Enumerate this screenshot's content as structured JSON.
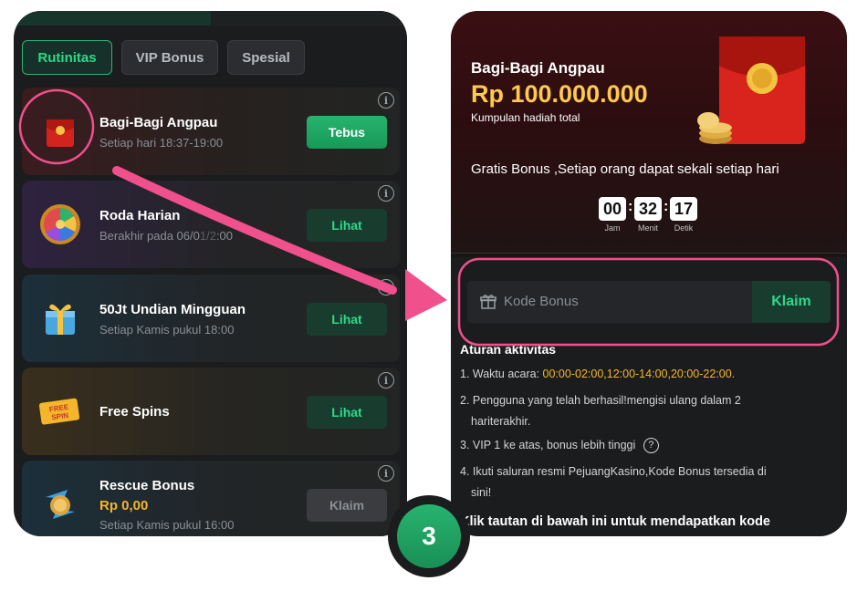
{
  "left": {
    "tabs": [
      {
        "label": "Rutinitas",
        "active": true
      },
      {
        "label": "VIP Bonus",
        "active": false
      },
      {
        "label": "Spesial",
        "active": false
      }
    ],
    "rows": [
      {
        "title": "Bagi-Bagi Angpau",
        "subtitle": "Setiap hari 18:37-19:00",
        "button": "Tebus",
        "icon": "red-envelope-icon"
      },
      {
        "title": "Roda Harian",
        "subtitle": "Berakhir pada 06/0",
        "subtitle_tail": ":00",
        "button": "Lihat",
        "icon": "wheel-icon"
      },
      {
        "title": "50Jt Undian Mingguan",
        "subtitle": "Setiap Kamis pukul 18:00",
        "button": "Lihat",
        "icon": "gift-box-icon"
      },
      {
        "title": "Free Spins",
        "subtitle": "",
        "button": "Lihat",
        "icon": "free-spin-ticket-icon",
        "ticket_text_1": "FREE",
        "ticket_text_2": "SPIN"
      },
      {
        "title": "Rescue Bonus",
        "amount": "Rp 0,00",
        "subtitle": "Setiap Kamis pukul 16:00",
        "button": "Klaim",
        "icon": "rescue-coin-icon"
      }
    ],
    "info_glyph": "i"
  },
  "right": {
    "hero_title": "Bagi-Bagi Angpau",
    "hero_amount": "Rp 100.000.000",
    "hero_caption": "Kumpulan hadiah total",
    "description": "Gratis Bonus ,Setiap orang dapat sekali setiap hari",
    "timer": [
      {
        "value": "00",
        "label": "Jam"
      },
      {
        "value": "32",
        "label": "Menit"
      },
      {
        "value": "17",
        "label": "Detik"
      }
    ],
    "code_placeholder": "Kode Bonus",
    "claim_button": "Klaim",
    "rules_title": "Aturan aktivitas",
    "rules": {
      "r1_prefix": "1. Waktu acara: ",
      "r1_highlight": "00:00-02:00,12:00-14:00,20:00-22:00.",
      "r2_line1": "2. Pengguna yang telah berhasil!mengisi ulang dalam 2",
      "r2_line2": "hariterakhir.",
      "r3": "3. VIP 1 ke atas, bonus lebih tinggi",
      "r3_icon": "?",
      "r4_line1": "4. Ikuti saluran resmi PejuangKasino,Kode Bonus tersedia di",
      "r4_line2": "sini!"
    },
    "bottom_link": "Klik tautan di bawah ini untuk mendapatkan kode"
  },
  "step_number": "3",
  "colors": {
    "accent_green": "#2fd889",
    "highlight_pink": "#f0508c",
    "gold": "#f5b62a"
  }
}
